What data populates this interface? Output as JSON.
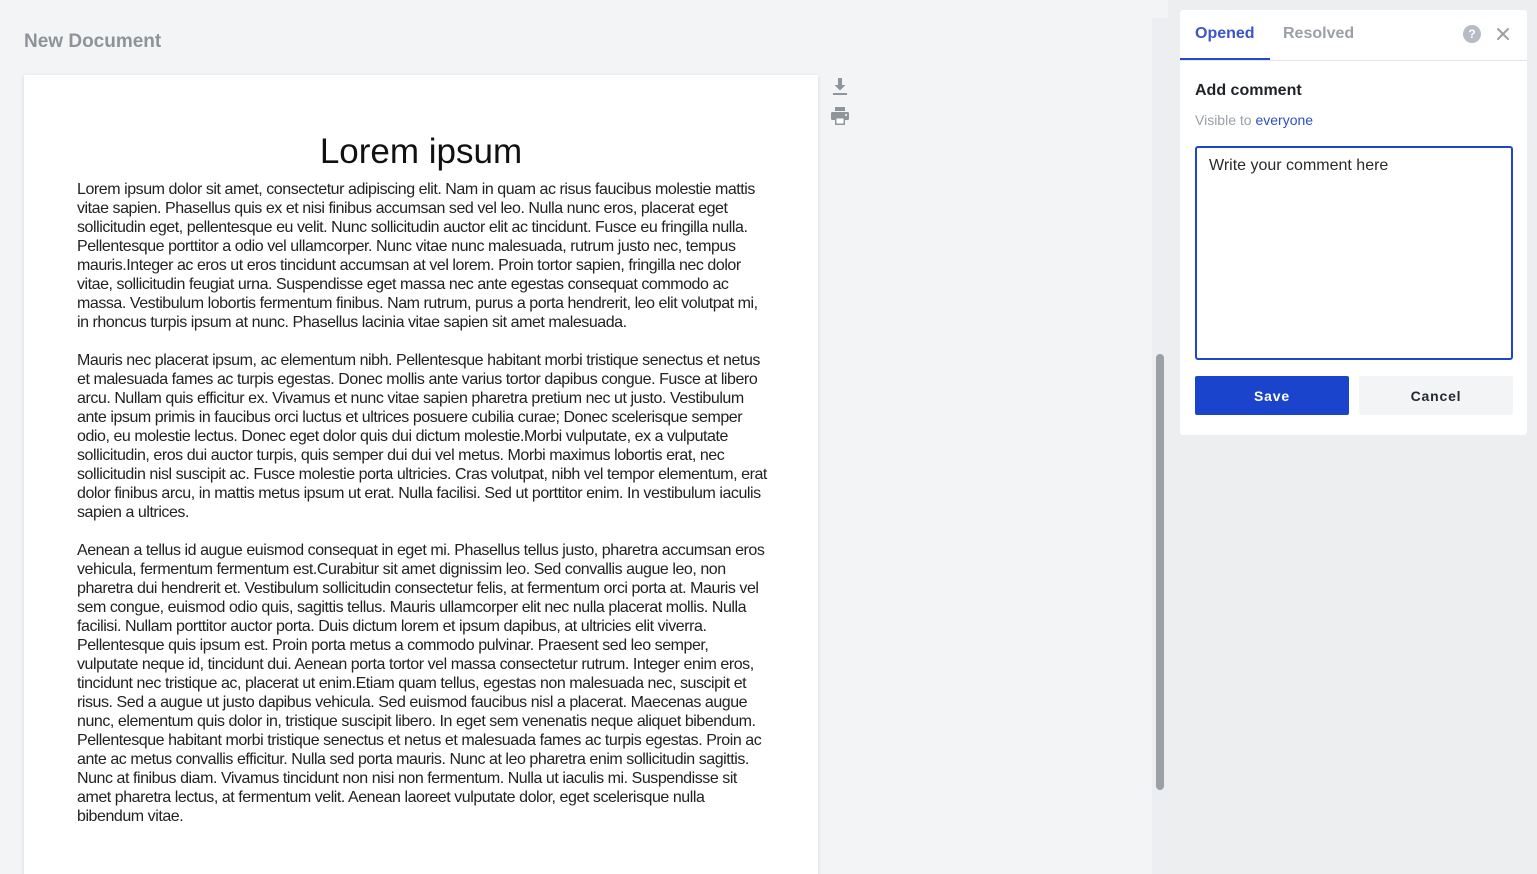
{
  "document": {
    "title": "New Document",
    "heading": "Lorem ipsum",
    "paragraphs": [
      "Lorem ipsum dolor sit amet, consectetur adipiscing elit. Nam in quam ac risus faucibus molestie mattis vitae sapien. Phasellus quis ex et nisi finibus accumsan sed vel leo. Nulla nunc eros, placerat eget sollicitudin eget, pellentesque eu velit. Nunc sollicitudin auctor elit ac tincidunt. Fusce eu fringilla nulla. Pellentesque porttitor a odio vel ullamcorper. Nunc vitae nunc malesuada, rutrum justo nec, tempus mauris.Integer ac eros ut eros tincidunt accumsan at vel lorem. Proin tortor sapien, fringilla nec dolor vitae, sollicitudin feugiat urna. Suspendisse eget massa nec ante egestas consequat commodo ac massa. Vestibulum lobortis fermentum finibus. Nam rutrum, purus a porta hendrerit, leo elit volutpat mi, in rhoncus turpis ipsum at nunc. Phasellus lacinia vitae sapien sit amet malesuada.",
      "Mauris nec placerat ipsum, ac elementum nibh. Pellentesque habitant morbi tristique senectus et netus et malesuada fames ac turpis egestas. Donec mollis ante varius tortor dapibus congue. Fusce at libero arcu. Nullam quis efficitur ex. Vivamus et nunc vitae sapien pharetra pretium nec ut justo. Vestibulum ante ipsum primis in faucibus orci luctus et ultrices posuere cubilia curae; Donec scelerisque semper odio, eu molestie lectus. Donec eget dolor quis dui dictum molestie.Morbi vulputate, ex a vulputate sollicitudin, eros dui auctor turpis, quis semper dui dui vel metus. Morbi maximus lobortis erat, nec sollicitudin nisl suscipit ac. Fusce molestie porta ultricies. Cras volutpat, nibh vel tempor elementum, erat dolor finibus arcu, in mattis metus ipsum ut erat. Nulla facilisi. Sed ut porttitor enim. In vestibulum iaculis sapien a ultrices.",
      "Aenean a tellus id augue euismod consequat in eget mi. Phasellus tellus justo, pharetra accumsan eros vehicula, fermentum fermentum est.Curabitur sit amet dignissim leo. Sed convallis augue leo, non pharetra dui hendrerit et. Vestibulum sollicitudin consectetur felis, at fermentum orci porta at. Mauris vel sem congue, euismod odio quis, sagittis tellus. Mauris ullamcorper elit nec nulla placerat mollis. Nulla facilisi. Nullam porttitor auctor porta. Duis dictum lorem et ipsum dapibus, at ultricies elit viverra. Pellentesque quis ipsum est. Proin porta metus a commodo pulvinar. Praesent sed leo semper, vulputate neque id, tincidunt dui. Aenean porta tortor vel massa consectetur rutrum. Integer enim eros, tincidunt nec tristique ac, placerat ut enim.Etiam quam tellus, egestas non malesuada nec, suscipit et risus. Sed a augue ut justo dapibus vehicula. Sed euismod faucibus nisl a placerat. Maecenas augue nunc, elementum quis dolor in, tristique suscipit libero. In eget sem venenatis neque aliquet bibendum. Pellentesque habitant morbi tristique senectus et netus et malesuada fames ac turpis egestas. Proin ac ante ac metus convallis efficitur. Nulla sed porta mauris. Nunc at leo pharetra enim sollicitudin sagittis. Nunc at finibus diam. Vivamus tincidunt non nisi non fermentum. Nulla ut iaculis mi. Suspendisse sit amet pharetra lectus, at fermentum velit. Aenean laoreet vulputate dolor, eget scelerisque nulla bibendum vitae."
    ]
  },
  "toolbar": {
    "download_icon": "download-icon",
    "print_icon": "print-icon"
  },
  "comments": {
    "tabs": [
      {
        "label": "Opened",
        "active": true
      },
      {
        "label": "Resolved",
        "active": false
      }
    ],
    "help_icon": "help-icon",
    "close_icon": "close-icon",
    "add_title": "Add comment",
    "visibility_prefix": "Visible to",
    "visibility_target": "everyone",
    "input_value": "Write your comment here",
    "save_label": "Save",
    "cancel_label": "Cancel"
  },
  "colors": {
    "accent": "#1a44cc",
    "background": "#f3f4f6",
    "panel": "#edeef0"
  }
}
